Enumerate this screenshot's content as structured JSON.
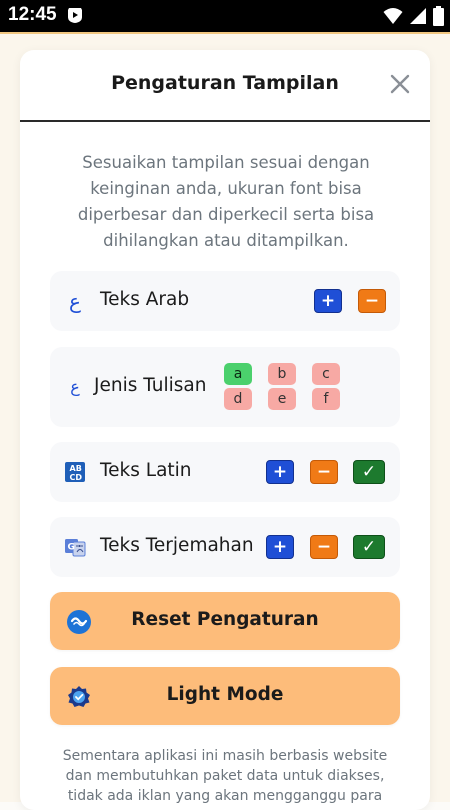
{
  "status_bar": {
    "time": "12:45"
  },
  "dialog": {
    "title": "Pengaturan Tampilan",
    "description": "Sesuaikan tampilan sesuai dengan keinginan anda, ukuran font bisa diperbesar dan diperkecil serta bisa dihilangkan atau ditampilkan.",
    "rows": [
      {
        "icon": "arabic-letter-icon",
        "icon_glyph": "ع",
        "label": "Teks Arab",
        "plus": "+",
        "minus": "−"
      },
      {
        "icon": "arabic-letter-icon",
        "icon_glyph": "ع",
        "label": "Jenis Tulisan",
        "font_options": [
          "a",
          "b",
          "c",
          "d",
          "e",
          "f"
        ],
        "selected": "a"
      },
      {
        "icon": "abcd-icon",
        "label": "Teks Latin",
        "plus": "+",
        "minus": "−",
        "check": "✓"
      },
      {
        "icon": "translate-icon",
        "label": "Teks Terjemahan",
        "plus": "+",
        "minus": "−",
        "check": "✓"
      }
    ],
    "reset_label": "Reset Pengaturan",
    "theme_label": "Light Mode",
    "footer": "Sementara aplikasi ini masih berbasis website dan membutuhkan paket data untuk diakses, tidak ada iklan yang akan mengganggu para"
  },
  "colors": {
    "accent_button": "#fdbc7a",
    "plus_button": "#1f4fd6",
    "minus_button": "#f07a16",
    "check_button": "#1d7a2e",
    "font_option_selected": "#4bd06c",
    "font_option": "#f7a9a4"
  }
}
